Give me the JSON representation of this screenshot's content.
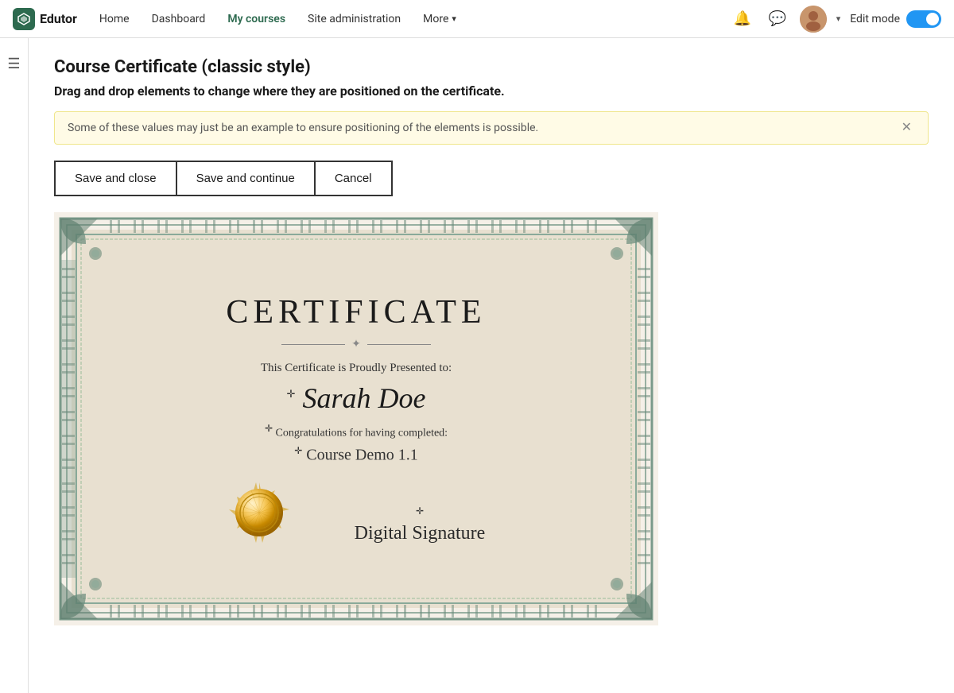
{
  "navbar": {
    "logo_text": "Edutor",
    "nav_items": [
      {
        "label": "Home",
        "active": false
      },
      {
        "label": "Dashboard",
        "active": false
      },
      {
        "label": "My courses",
        "active": true
      },
      {
        "label": "Site administration",
        "active": false
      },
      {
        "label": "More",
        "has_dropdown": true,
        "active": false
      }
    ],
    "edit_mode_label": "Edit mode",
    "edit_mode_on": true
  },
  "sidebar": {
    "icon": "☰"
  },
  "page": {
    "title": "Course Certificate (classic style)",
    "subtitle": "Drag and drop elements to change where they are positioned on the certificate.",
    "alert_text": "Some of these values may just be an example to ensure positioning of the elements is possible.",
    "buttons": [
      {
        "label": "Save and close",
        "name": "save-close-button"
      },
      {
        "label": "Save and continue",
        "name": "save-continue-button"
      },
      {
        "label": "Cancel",
        "name": "cancel-button"
      }
    ]
  },
  "certificate": {
    "title": "CERTIFICATE",
    "presented_text": "This Certificate is Proudly Presented to:",
    "recipient_name": "Sarah Doe",
    "congrats_text": "Congratulations for having completed:",
    "course_name": "Course Demo 1.1",
    "signature_text": "Digital Signature"
  }
}
